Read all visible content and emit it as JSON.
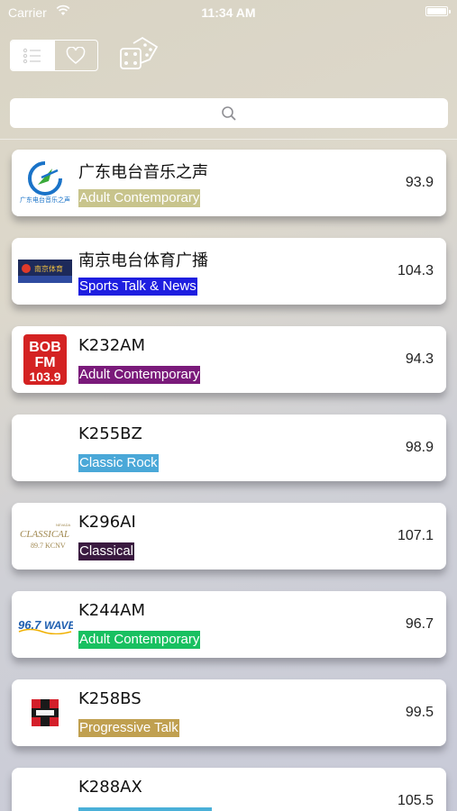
{
  "status_bar": {
    "carrier": "Carrier",
    "time": "11:34 AM"
  },
  "toolbar": {
    "list_mode_icon": "list-icon",
    "favorites_mode_icon": "heart-icon",
    "random_icon": "dice-icon"
  },
  "search": {
    "placeholder": "",
    "value": "",
    "icon": "search-icon"
  },
  "stations": [
    {
      "name": "广东电台音乐之声",
      "genre": "Adult Contemporary",
      "genre_color": "#c8c48c",
      "frequency": "93.9",
      "logo": "guangdong-radio-logo",
      "logo_text": "广东电台音乐之声"
    },
    {
      "name": "南京电台体育广播",
      "genre": "Sports Talk & News",
      "genre_color": "#1e1ee0",
      "frequency": "104.3",
      "logo": "nanjing-sports-logo",
      "logo_text": "南京体育"
    },
    {
      "name": "K232AM",
      "genre": "Adult Contemporary",
      "genre_color": "#7a1a7a",
      "frequency": "94.3",
      "logo": "bob-fm-logo",
      "logo_text": "BOB FM 103.9"
    },
    {
      "name": "K255BZ",
      "genre": "Classic Rock",
      "genre_color": "#4aa8d8",
      "frequency": "98.9",
      "logo": "",
      "logo_text": ""
    },
    {
      "name": "K296AI",
      "genre": "Classical",
      "genre_color": "#3a1a40",
      "frequency": "107.1",
      "logo": "classical-kcnv-logo",
      "logo_text": "CLASSICAL 89.7 KCNV"
    },
    {
      "name": "K244AM",
      "genre": "Adult Contemporary",
      "genre_color": "#18c060",
      "frequency": "96.7",
      "logo": "wave-logo",
      "logo_text": "96.7 WAVE"
    },
    {
      "name": "K258BS",
      "genre": "Progressive Talk",
      "genre_color": "#c0a050",
      "frequency": "99.5",
      "logo": "progressive-talk-logo",
      "logo_text": ""
    },
    {
      "name": "K288AX",
      "genre": "",
      "genre_color": "#4ab0d8",
      "frequency": "105.5",
      "logo": "",
      "logo_text": ""
    }
  ]
}
